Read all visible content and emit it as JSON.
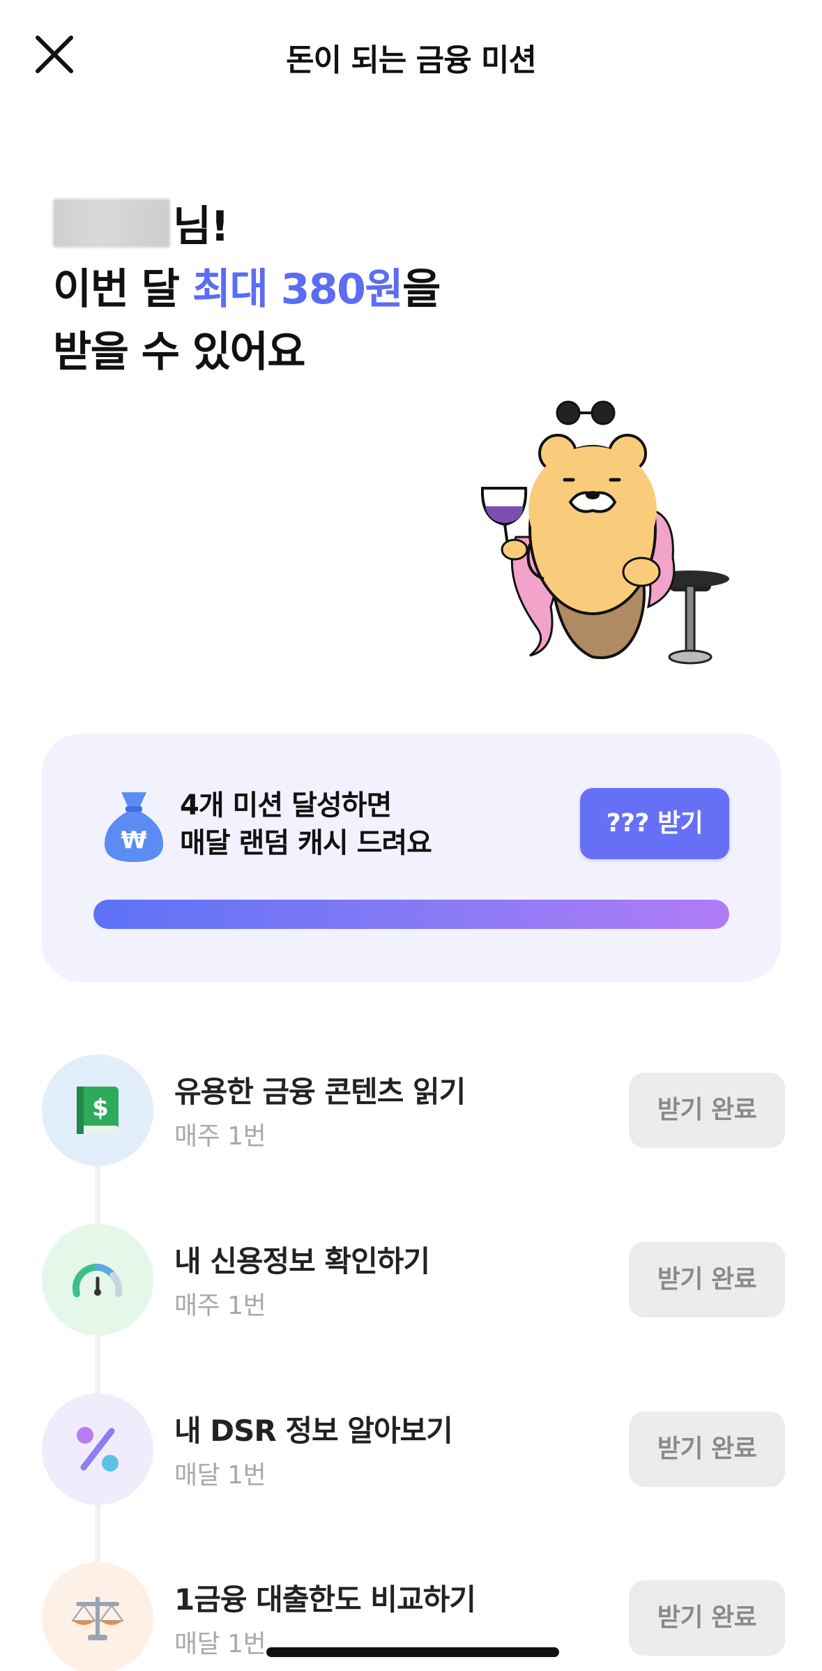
{
  "header": {
    "title": "돈이 되는 금융 미션",
    "close_icon": "close-icon"
  },
  "hero": {
    "name_suffix": "님!",
    "line2_prefix": "이번 달 ",
    "line2_accent": "최대 380원",
    "line2_suffix": "을",
    "line3": "받을 수 있어요",
    "accent_color": "#5b6cf6"
  },
  "mission_card": {
    "icon": "money-bag-icon",
    "line1": "4개 미션 달성하면",
    "line2": "매달 랜덤 캐시 드려요",
    "button_label": "??? 받기",
    "progress": 1.0
  },
  "missions": [
    {
      "title": "유용한 금융 콘텐츠 읽기",
      "frequency": "매주 1번",
      "button_label": "받기 완료",
      "icon": "finance-book-icon",
      "bg": "#e3eefb"
    },
    {
      "title": "내 신용정보 확인하기",
      "frequency": "매주 1번",
      "button_label": "받기 완료",
      "icon": "gauge-icon",
      "bg": "#e5f7e9"
    },
    {
      "title": "내 DSR 정보 알아보기",
      "frequency": "매달 1번",
      "button_label": "받기 완료",
      "icon": "percent-icon",
      "bg": "#f1ecfc"
    },
    {
      "title": "1금융 대출한도 비교하기",
      "frequency": "매달 1번",
      "button_label": "받기 완료",
      "icon": "scale-icon",
      "bg": "#fdf0e6"
    }
  ]
}
